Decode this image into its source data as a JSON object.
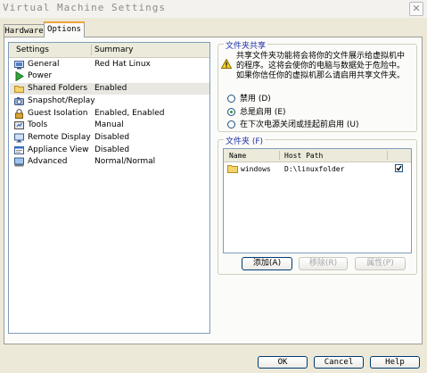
{
  "window": {
    "title": "Virtual Machine Settings",
    "close_glyph": "✕"
  },
  "tabs": [
    {
      "label": "Hardware"
    },
    {
      "label": "Options"
    }
  ],
  "settings_list": {
    "columns": {
      "settings": "Settings",
      "summary": "Summary"
    },
    "items": [
      {
        "label": "General",
        "summary": "Red Hat Linux",
        "icon": "general-icon"
      },
      {
        "label": "Power",
        "summary": "",
        "icon": "power-icon"
      },
      {
        "label": "Shared Folders",
        "summary": "Enabled",
        "icon": "folder-icon",
        "selected": true
      },
      {
        "label": "Snapshot/Replay",
        "summary": "",
        "icon": "snapshot-icon"
      },
      {
        "label": "Guest Isolation",
        "summary": "Enabled, Enabled",
        "icon": "lock-icon"
      },
      {
        "label": "Tools",
        "summary": "Manual",
        "icon": "tools-icon"
      },
      {
        "label": "Remote Display",
        "summary": "Disabled",
        "icon": "remote-display-icon"
      },
      {
        "label": "Appliance View",
        "summary": "Disabled",
        "icon": "appliance-icon"
      },
      {
        "label": "Advanced",
        "summary": "Normal/Normal",
        "icon": "advanced-icon"
      }
    ]
  },
  "folder_sharing": {
    "legend": "文件夹共享",
    "warning": "共享文件夹功能将会将你的文件展示给虚拟机中的程序。这将会使你的电脑与数据处于危险中。如果你信任你的虚拟机那么请启用共享文件夹。",
    "options": [
      {
        "label": "禁用 (D)",
        "checked": false
      },
      {
        "label": "总是启用 (E)",
        "checked": true
      },
      {
        "label": "在下次电源关闭或挂起前启用 (U)",
        "checked": false
      }
    ]
  },
  "folders": {
    "legend": "文件夹 (F)",
    "columns": {
      "name": "Name",
      "host_path": "Host Path"
    },
    "rows": [
      {
        "name": "windows",
        "host_path": "D:\\linuxfolder",
        "enabled": true
      }
    ],
    "buttons": {
      "add": "添加(A)",
      "remove": "移除(R)",
      "properties": "属性(P)"
    }
  },
  "footer": {
    "ok": "OK",
    "cancel": "Cancel",
    "help": "Help"
  },
  "colors": {
    "accent_tab": "#f1a33a",
    "group_title": "#1f2fa8",
    "dialog_bg": "#ece9d8"
  }
}
